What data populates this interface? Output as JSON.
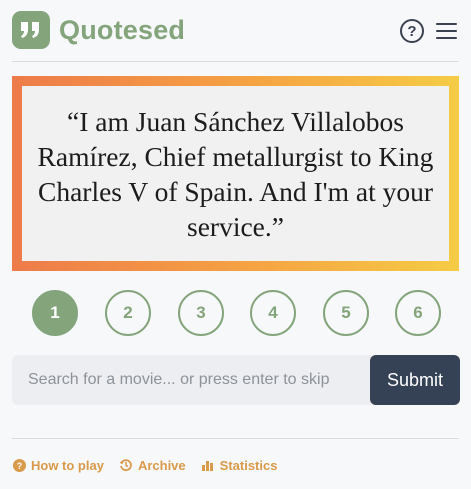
{
  "header": {
    "logo_glyph": "”",
    "title": "Quotesed",
    "help_glyph": "?"
  },
  "quote": {
    "text": "“I am Juan Sánchez Villalobos Ramírez, Chief metallurgist to King Charles V of Spain. And I'm at your service.”"
  },
  "steps": [
    {
      "label": "1",
      "active": true
    },
    {
      "label": "2",
      "active": false
    },
    {
      "label": "3",
      "active": false
    },
    {
      "label": "4",
      "active": false
    },
    {
      "label": "5",
      "active": false
    },
    {
      "label": "6",
      "active": false
    }
  ],
  "search": {
    "value": "",
    "placeholder": "Search for a movie... or press enter to skip",
    "submit_label": "Submit"
  },
  "footer": {
    "links": [
      {
        "label": "How to play",
        "icon": "question-circle-icon"
      },
      {
        "label": "Archive",
        "icon": "history-icon"
      },
      {
        "label": "Statistics",
        "icon": "bar-chart-icon"
      }
    ]
  },
  "colors": {
    "brand_green": "#84a47c",
    "dark_navy": "#354154",
    "link_orange": "#d99a4b",
    "gradient": [
      "#ee7b4a",
      "#f5a443",
      "#f5cc45"
    ]
  }
}
